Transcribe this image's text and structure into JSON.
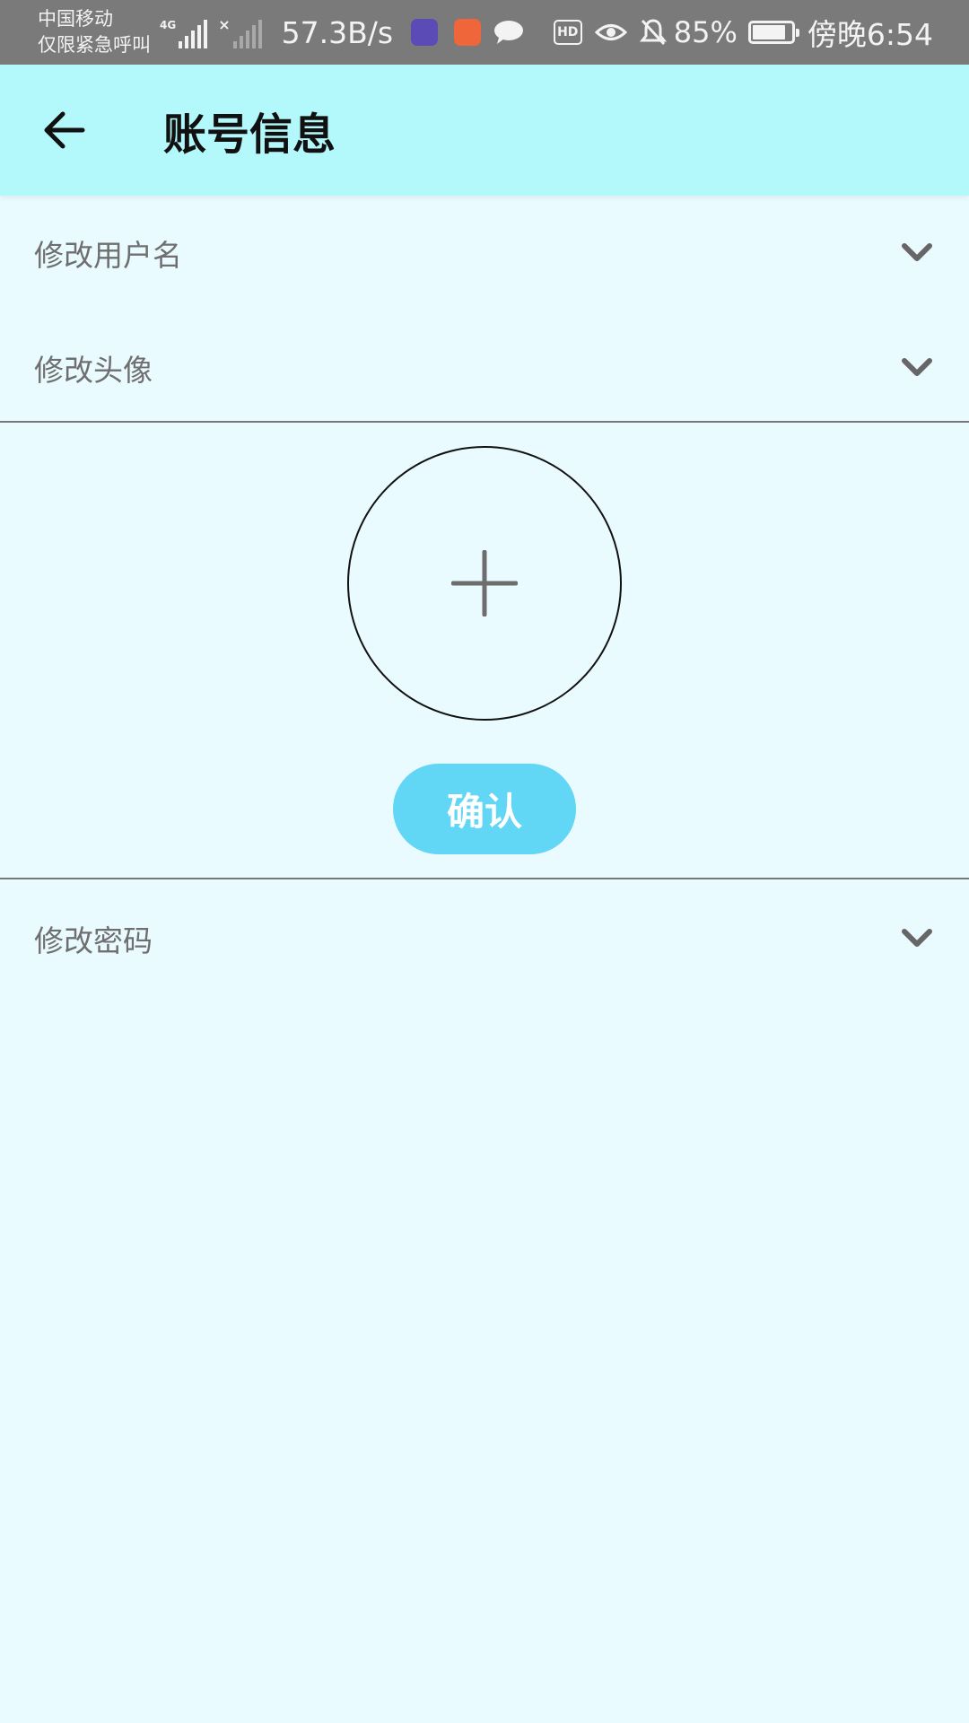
{
  "status_bar": {
    "carrier_line1": "中国移动",
    "carrier_line2": "仅限紧急呼叫",
    "network_type": "4G",
    "speed": "57.3B/s",
    "battery_percent": "85%",
    "battery_level": 0.85,
    "time": "傍晚6:54",
    "hd_label": "HD",
    "icons": [
      "signal-icon",
      "no-signal-icon",
      "app-purple-icon",
      "app-orange-icon",
      "chat-icon",
      "hd-icon",
      "eye-icon",
      "bell-off-icon",
      "battery-icon"
    ]
  },
  "header": {
    "title": "账号信息",
    "back_icon": "arrow-left-icon"
  },
  "sections": {
    "username": {
      "label": "修改用户名",
      "icon": "chevron-down-icon"
    },
    "avatar": {
      "label": "修改头像",
      "icon": "chevron-down-icon"
    },
    "password": {
      "label": "修改密码",
      "icon": "chevron-down-icon"
    }
  },
  "avatar_panel": {
    "add_icon": "plus-icon",
    "confirm_label": "确认"
  },
  "colors": {
    "header_bg": "#b3f8fb",
    "page_bg": "#eafbff",
    "confirm_bg": "#62d6f5",
    "status_bar_bg": "#7a7a7a"
  }
}
